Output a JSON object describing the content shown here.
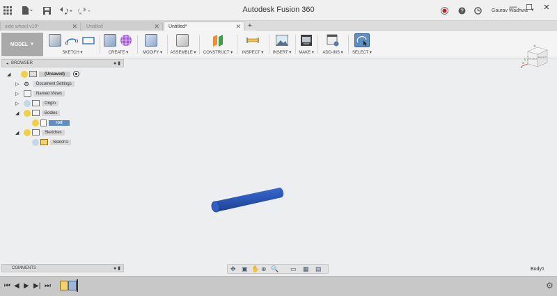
{
  "window": {
    "title": "Autodesk Fusion 360",
    "user": "Gaurav Wadhwa",
    "controls": {
      "minimize": "—",
      "maximize": "☐",
      "close": "✕"
    }
  },
  "quick_access": {
    "grid_icon": "apps-grid-icon",
    "file_icon": "file-icon",
    "save_icon": "save-icon",
    "undo_icon": "undo-icon",
    "redo_icon": "redo-icon"
  },
  "tabs": [
    {
      "label": "side wheel v10*"
    },
    {
      "label": "Untitled"
    },
    {
      "label": "Untitled*"
    }
  ],
  "new_tab": "+",
  "toolbar": {
    "workspace": "MODEL",
    "groups": [
      {
        "label": "SKETCH ▾"
      },
      {
        "label": "CREATE ▾"
      },
      {
        "label": "MODIFY ▾"
      },
      {
        "label": "ASSEMBLE ▾"
      },
      {
        "label": "CONSTRUCT ▾"
      },
      {
        "label": "INSPECT ▾"
      },
      {
        "label": "INSERT ▾"
      },
      {
        "label": "MAKE ▾"
      },
      {
        "label": "ADD-INS ▾"
      },
      {
        "label": "SELECT ▾"
      }
    ]
  },
  "browser": {
    "title": "BROWSER",
    "nodes": [
      {
        "label": "(Unsaved)"
      },
      {
        "label": "Document Settings"
      },
      {
        "label": "Named Views"
      },
      {
        "label": "Origin"
      },
      {
        "label": "Bodies"
      },
      {
        "label": "rod"
      },
      {
        "label": "Sketches"
      },
      {
        "label": "Sketch1"
      }
    ]
  },
  "viewcube": {
    "front": "FRONT",
    "right": "RIGHT",
    "axis_x": "x",
    "axis_y": "y",
    "axis_z": "z"
  },
  "comments": {
    "title": "COMMENTS"
  },
  "status": {
    "selection": "Body1"
  },
  "colors": {
    "accent": "#5e8ec3",
    "body": "#2b58b9",
    "workspace_btn": "#a9a9a9"
  }
}
